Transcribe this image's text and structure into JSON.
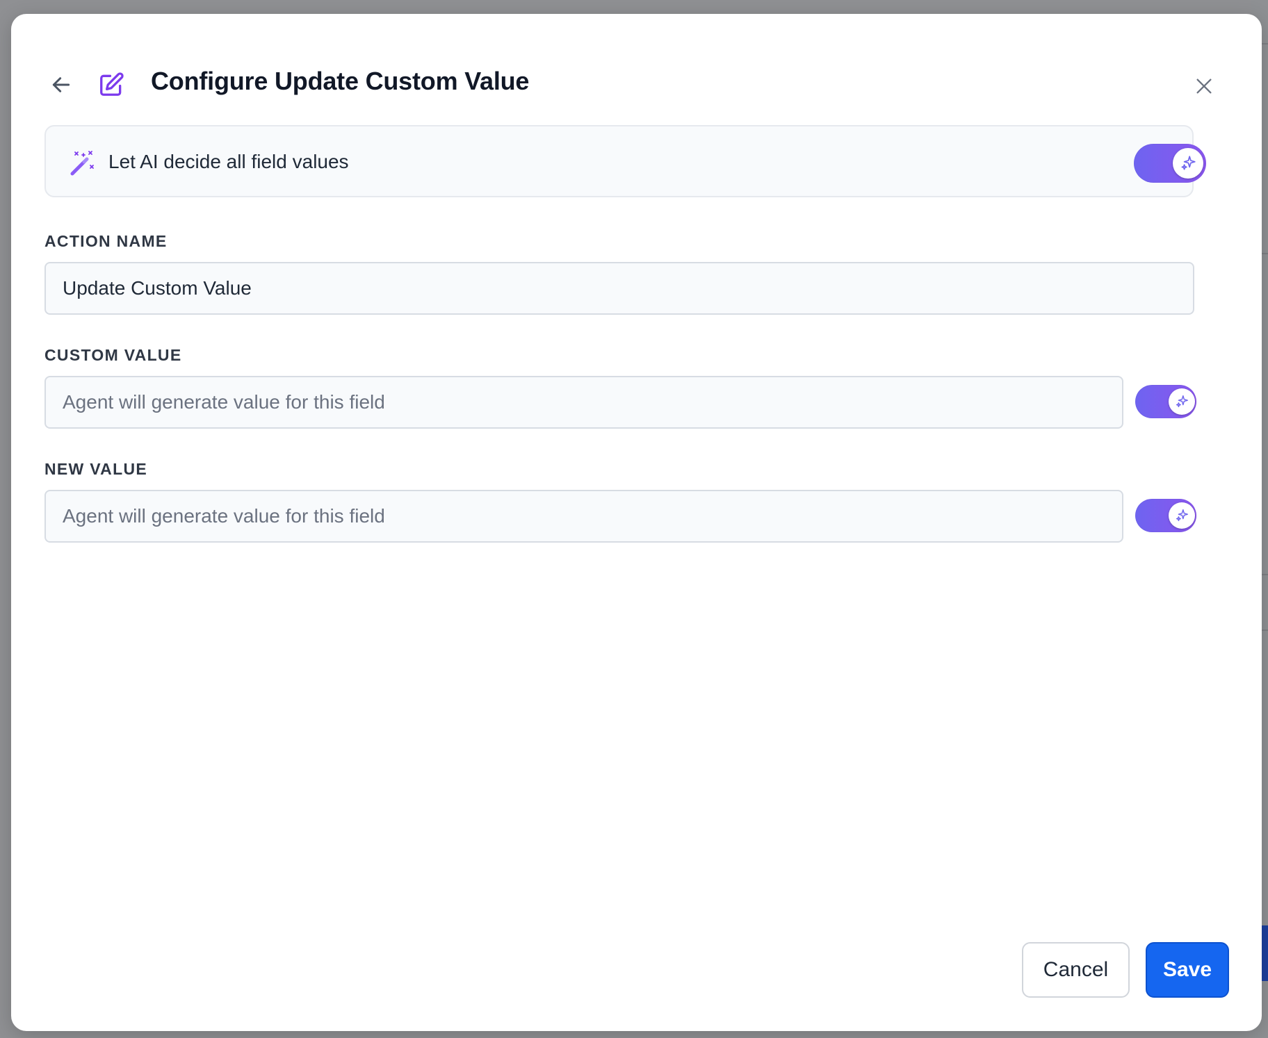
{
  "modal": {
    "title": "Configure Update Custom Value",
    "ai_toggle": {
      "label": "Let AI decide all field values",
      "enabled": true
    },
    "fields": [
      {
        "label": "ACTION NAME",
        "value": "Update Custom Value",
        "placeholder": ""
      },
      {
        "label": "CUSTOM VALUE",
        "value": "",
        "placeholder": "Agent will generate value for this field",
        "ai_enabled": true
      },
      {
        "label": "NEW VALUE",
        "value": "",
        "placeholder": "Agent will generate value for this field",
        "ai_enabled": true
      }
    ],
    "footer": {
      "cancel_label": "Cancel",
      "save_label": "Save"
    }
  },
  "colors": {
    "accent_purple": "#7b5cf0",
    "primary_blue": "#1566f0",
    "backdrop": "#8f9093"
  },
  "icons": {
    "back": "arrow-left-icon",
    "edit": "edit-square-icon",
    "close": "close-icon",
    "wand": "magic-wand-icon",
    "sparkle": "sparkle-icon"
  }
}
